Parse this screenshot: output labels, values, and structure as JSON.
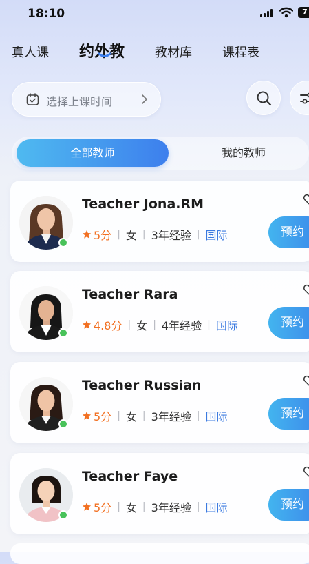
{
  "status_bar": {
    "time": "18:10",
    "battery": "7"
  },
  "top_tabs": [
    {
      "label": "真人课",
      "active": false
    },
    {
      "label": "约外教",
      "active": true
    },
    {
      "label": "教材库",
      "active": false
    },
    {
      "label": "课程表",
      "active": false
    }
  ],
  "date_picker": {
    "label": "选择上课时间"
  },
  "segments": {
    "all": "全部教师",
    "mine": "我的教师"
  },
  "teachers": [
    {
      "name": "Teacher Jona.RM",
      "rating": "5分",
      "gender": "女",
      "experience": "3年经验",
      "region": "国际",
      "book": "预约"
    },
    {
      "name": "Teacher Rara",
      "rating": "4.8分",
      "gender": "女",
      "experience": "4年经验",
      "region": "国际",
      "book": "预约"
    },
    {
      "name": "Teacher Russian",
      "rating": "5分",
      "gender": "女",
      "experience": "3年经验",
      "region": "国际",
      "book": "预约"
    },
    {
      "name": "Teacher Faye",
      "rating": "5分",
      "gender": "女",
      "experience": "3年经验",
      "region": "国际",
      "book": "预约"
    }
  ],
  "colors": {
    "accent": "#3d7fed",
    "rating": "#f27022",
    "region": "#3b7ae0",
    "online": "#49c25a"
  }
}
